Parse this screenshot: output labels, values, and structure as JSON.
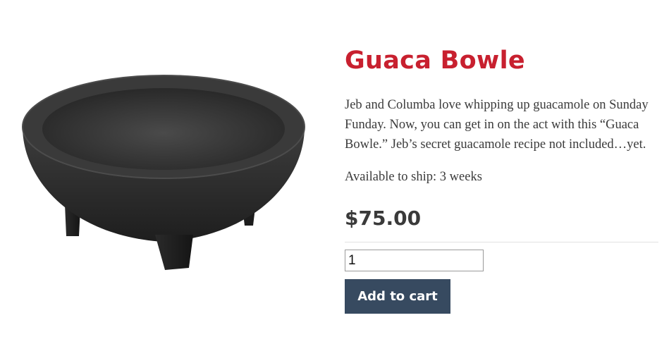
{
  "product": {
    "title": "Guaca Bowle",
    "description": "Jeb and Columba love whipping up guacamole on Sunday Funday. Now, you can get in on the act with this “Guaca Bowle.” Jeb’s secret guacamole recipe not included…yet.",
    "availability": "Available to ship: 3 weeks",
    "price": "$75.00",
    "image_icon": "molcajete-bowl-image"
  },
  "cart": {
    "quantity": "1",
    "add_label": "Add to cart"
  },
  "colors": {
    "title": "#c8202f",
    "button": "#374a60",
    "text": "#3b3b3b"
  }
}
